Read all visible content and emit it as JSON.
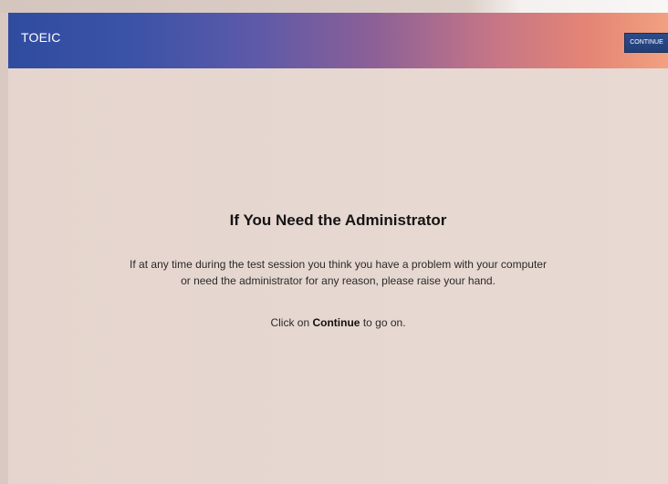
{
  "header": {
    "title": "TOEIC",
    "continue_label": "CONTINUE"
  },
  "main": {
    "heading": "If You Need the Administrator",
    "body_line1": "If at any time during the test session you think you have a problem with your computer",
    "body_line2": "or need the administrator for any reason, please raise your hand.",
    "instruction_prefix": "Click on",
    "instruction_action": "Continue",
    "instruction_suffix": "to go on."
  }
}
